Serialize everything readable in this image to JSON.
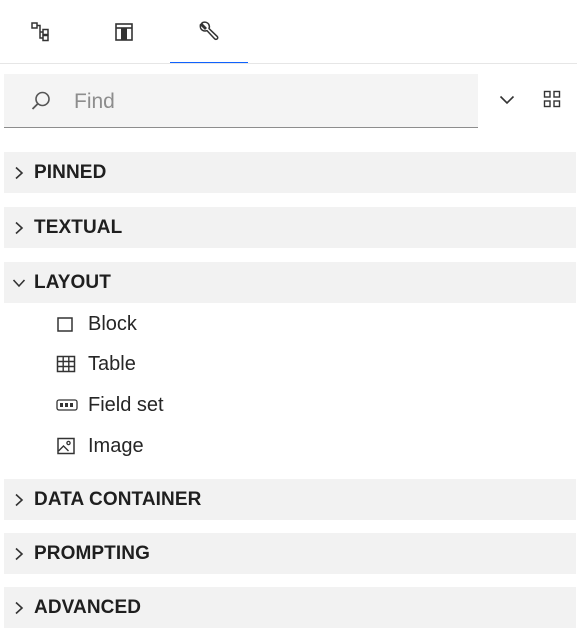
{
  "tabs": [
    {
      "name": "data-tree-icon",
      "active": false
    },
    {
      "name": "layout-panel-icon",
      "active": false
    },
    {
      "name": "wrench-icon",
      "active": true
    }
  ],
  "search": {
    "placeholder": "Find",
    "value": ""
  },
  "toolbar": {
    "expand_icon": "chevron-down-icon",
    "view_icon": "grid-view-icon"
  },
  "sections": [
    {
      "label": "PINNED",
      "expanded": false
    },
    {
      "label": "TEXTUAL",
      "expanded": false
    },
    {
      "label": "LAYOUT",
      "expanded": true,
      "items": [
        {
          "label": "Block",
          "icon": "block-icon"
        },
        {
          "label": "Table",
          "icon": "table-icon"
        },
        {
          "label": "Field set",
          "icon": "field-set-icon"
        },
        {
          "label": "Image",
          "icon": "image-icon"
        }
      ]
    },
    {
      "label": "DATA CONTAINER",
      "expanded": false
    },
    {
      "label": "PROMPTING",
      "expanded": false
    },
    {
      "label": "ADVANCED",
      "expanded": false
    }
  ],
  "colors": {
    "accent": "#0f62fe",
    "section_bg": "#f2f2f2",
    "search_bg": "#f4f4f4"
  }
}
